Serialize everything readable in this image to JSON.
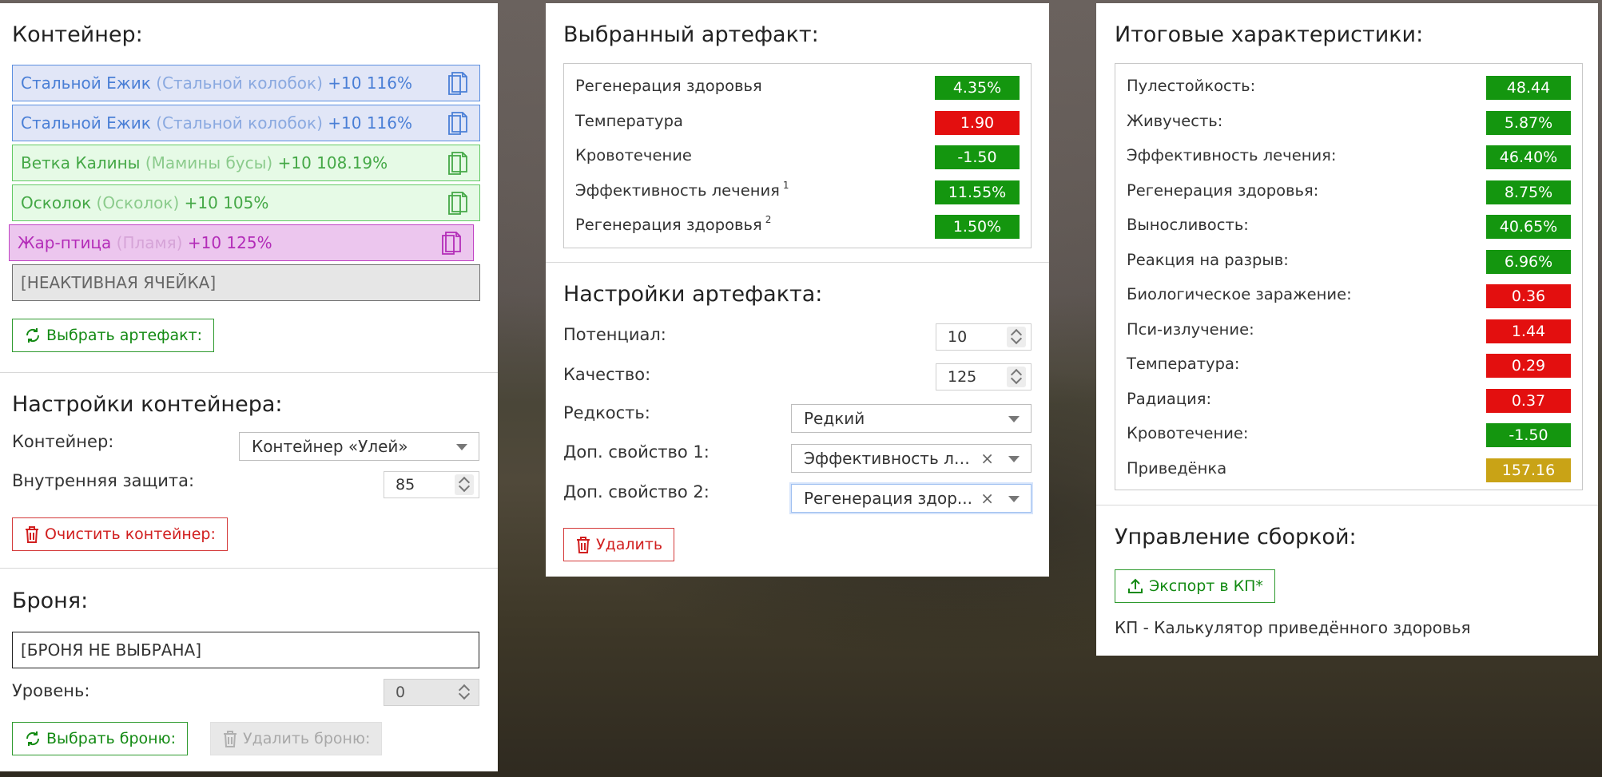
{
  "container_panel": {
    "title": "Контейнер:",
    "slots": [
      {
        "name": "Стальной Ежик",
        "alt": "(Стальной колобок)",
        "stats": "+10 116%",
        "color": "blue"
      },
      {
        "name": "Стальной Ежик",
        "alt": "(Стальной колобок)",
        "stats": "+10 116%",
        "color": "blue"
      },
      {
        "name": "Ветка Калины",
        "alt": "(Мамины бусы)",
        "stats": "+10 108.19%",
        "color": "green"
      },
      {
        "name": "Осколок",
        "alt": "(Осколок)",
        "stats": "+10 105%",
        "color": "green"
      },
      {
        "name": "Жар-птица",
        "alt": "(Пламя)",
        "stats": "+10 125%",
        "color": "pink"
      },
      {
        "name": "[НЕАКТИВНАЯ ЯЧЕЙКА]",
        "alt": "",
        "stats": "",
        "color": "gray"
      }
    ],
    "select_artifact_button": "Выбрать артефакт:"
  },
  "container_settings": {
    "title": "Настройки контейнера:",
    "container_label": "Контейнер:",
    "container_value": "Контейнер «Улей»",
    "inner_protection_label": "Внутренняя защита:",
    "inner_protection_value": "85",
    "clear_button": "Очистить контейнер:"
  },
  "armor": {
    "title": "Броня:",
    "armor_value": "[БРОНЯ НЕ ВЫБРАНА]",
    "level_label": "Уровень:",
    "level_value": "0",
    "select_button": "Выбрать броню:",
    "delete_button": "Удалить броню:"
  },
  "selected_artifact": {
    "title": "Выбранный артефакт:",
    "stats": [
      {
        "name": "Регенерация здоровья",
        "sup": "",
        "value": "4.35%",
        "color": "green"
      },
      {
        "name": "Температура",
        "sup": "",
        "value": "1.90",
        "color": "red"
      },
      {
        "name": "Кровотечение",
        "sup": "",
        "value": "-1.50",
        "color": "green"
      },
      {
        "name": "Эффективность лечения",
        "sup": "1",
        "value": "11.55%",
        "color": "green"
      },
      {
        "name": "Регенерация здоровья",
        "sup": "2",
        "value": "1.50%",
        "color": "green"
      }
    ]
  },
  "artifact_settings": {
    "title": "Настройки артефакта:",
    "potential_label": "Потенциал:",
    "potential_value": "10",
    "quality_label": "Качество:",
    "quality_value": "125",
    "rarity_label": "Редкость:",
    "rarity_value": "Редкий",
    "extra1_label": "Доп. свойство 1:",
    "extra1_value": "Эффективность ле...",
    "extra2_label": "Доп. свойство 2:",
    "extra2_value": "Регенерация здор...",
    "clear_symbol": "×",
    "delete_button": "Удалить"
  },
  "totals": {
    "title": "Итоговые характеристики:",
    "stats": [
      {
        "name": "Пулестойкость:",
        "value": "48.44",
        "color": "green"
      },
      {
        "name": "Живучесть:",
        "value": "5.87%",
        "color": "green"
      },
      {
        "name": "Эффективность лечения:",
        "value": "46.40%",
        "color": "green"
      },
      {
        "name": "Регенерация здоровья:",
        "value": "8.75%",
        "color": "green"
      },
      {
        "name": "Выносливость:",
        "value": "40.65%",
        "color": "green"
      },
      {
        "name": "Реакция на разрыв:",
        "value": "6.96%",
        "color": "green"
      },
      {
        "name": "Биологическое заражение:",
        "value": "0.36",
        "color": "red"
      },
      {
        "name": "Пси-излучение:",
        "value": "1.44",
        "color": "red"
      },
      {
        "name": "Температура:",
        "value": "0.29",
        "color": "red"
      },
      {
        "name": "Радиация:",
        "value": "0.37",
        "color": "red"
      },
      {
        "name": "Кровотечение:",
        "value": "-1.50",
        "color": "green"
      },
      {
        "name": "Приведёнка",
        "value": "157.16",
        "color": "gold"
      }
    ]
  },
  "build_management": {
    "title": "Управление сборкой:",
    "export_button": "Экспорт в КП*",
    "footnote": "КП - Калькулятор приведённого здоровья"
  },
  "icons": {
    "copy": "copy-icon",
    "refresh": "refresh-icon",
    "trash": "trash-icon",
    "upload": "upload-icon",
    "caret": "chevron-down-icon"
  },
  "colors": {
    "stat_green": "#14960f",
    "stat_red": "#e30f0f",
    "stat_gold": "#c9a316",
    "slot_blue": "#4a7fd6",
    "slot_green": "#44a846",
    "slot_pink": "#b32cb8"
  }
}
